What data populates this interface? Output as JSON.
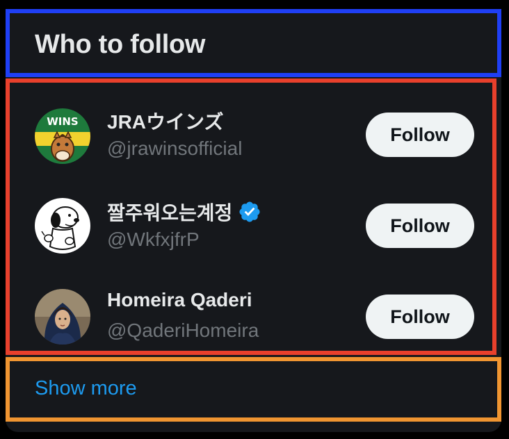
{
  "widget": {
    "title": "Who to follow",
    "show_more_label": "Show more",
    "accent_color": "#1d9bf0",
    "highlight_colors": [
      "#1f3ff5",
      "#e8402c",
      "#f09531"
    ]
  },
  "accounts": [
    {
      "name": "JRAウインズ",
      "handle": "@jrawinsofficial",
      "verified": false,
      "avatar_icon": "horse-logo-icon",
      "avatar_text": "WINS",
      "button_label": "Follow"
    },
    {
      "name": "짤주워오는계정",
      "handle": "@WkfxjfrP",
      "verified": true,
      "avatar_icon": "cartoon-dog-icon",
      "button_label": "Follow"
    },
    {
      "name": "Homeira Qaderi",
      "handle": "@QaderiHomeira",
      "verified": false,
      "avatar_icon": "profile-photo-icon",
      "button_label": "Follow"
    }
  ]
}
